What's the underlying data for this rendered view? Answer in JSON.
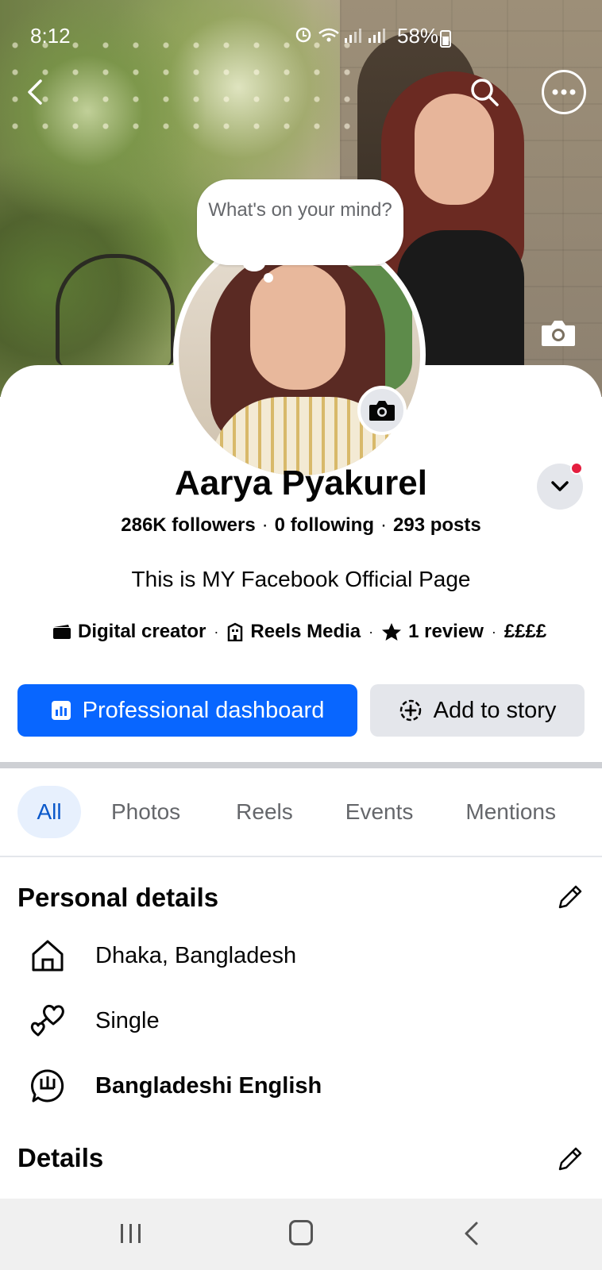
{
  "status_bar": {
    "time": "8:12",
    "battery": "58%"
  },
  "profile": {
    "thought_prompt": "What's on your mind?",
    "name": "Aarya Pyakurel",
    "followers": "286K followers",
    "following": "0 following",
    "posts": "293 posts",
    "bio": "This is MY Facebook Official Page",
    "category": "Digital creator",
    "company": "Reels Media",
    "reviews": "1 review",
    "price_range": "££££"
  },
  "actions": {
    "dashboard_label": "Professional dashboard",
    "story_label": "Add to story"
  },
  "tabs": [
    {
      "label": "All",
      "active": true
    },
    {
      "label": "Photos",
      "active": false
    },
    {
      "label": "Reels",
      "active": false
    },
    {
      "label": "Events",
      "active": false
    },
    {
      "label": "Mentions",
      "active": false
    }
  ],
  "personal_details": {
    "title": "Personal details",
    "items": [
      {
        "icon": "home-icon",
        "text": "Dhaka, Bangladesh"
      },
      {
        "icon": "hearts-icon",
        "text": "Single"
      },
      {
        "icon": "language-icon",
        "text": "Bangladeshi English"
      }
    ]
  },
  "details": {
    "title": "Details"
  },
  "colors": {
    "primary": "#0866ff",
    "secondary_button": "#e4e6eb",
    "active_tab_bg": "#e7f0fd",
    "active_tab_text": "#0a58ca",
    "notification_dot": "#e41e3f"
  }
}
